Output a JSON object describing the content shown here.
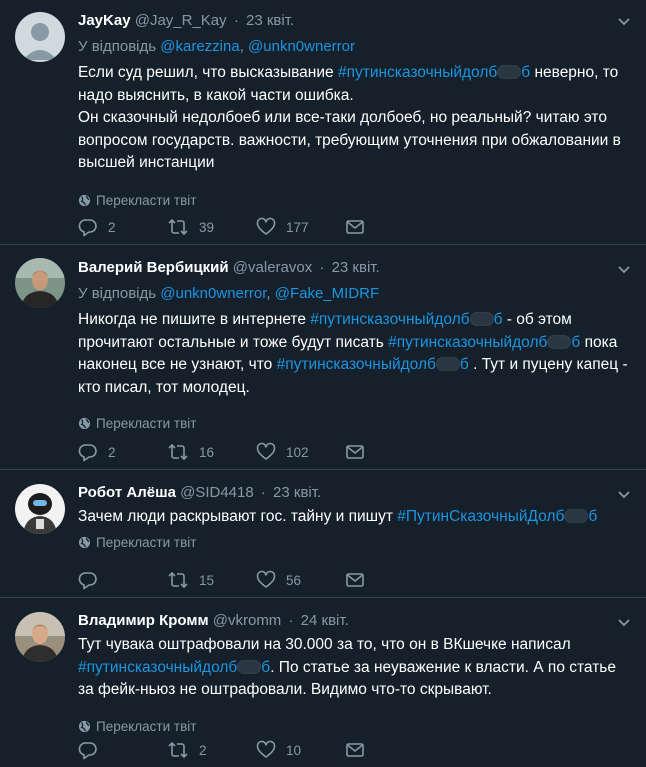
{
  "tweets": [
    {
      "name": "JayKay",
      "handle": "@Jay_R_Kay",
      "sep": "·",
      "date": "23 квіт.",
      "reply_prefix": "У відповідь",
      "reply_mentions": [
        "@karezzina",
        "@unkn0wnerror"
      ],
      "text_parts": [
        "Если суд решил, что высказывание ",
        "#путинсказочныйдолб",
        " неверно, то надо выяснить, в какой части ошибка.",
        "Он сказочный недолбоеб или все-таки долбоеб, но реальный? читаю это вопросом государств. важности, требующим уточнения при обжаловании в высшей инстанции"
      ],
      "translate": "Перекласти твіт",
      "replies": "2",
      "retweets": "39",
      "likes": "177"
    },
    {
      "name": "Валерий Вербицкий",
      "handle": "@valeravox",
      "sep": "·",
      "date": "23 квіт.",
      "reply_prefix": "У відповідь",
      "reply_mentions": [
        "@unkn0wnerror",
        "@Fake_MIDRF"
      ],
      "text_parts": [
        "Никогда не пишите в интернете ",
        "#путинсказочныйдолб",
        " - об этом прочитают остальные и тоже будут писать ",
        "#путинсказочныйдолб",
        " пока наконец все не узнают, что ",
        "#путинсказочныйдолб",
        " . Тут и пуцену капец - кто писал, тот молодец."
      ],
      "translate": "Перекласти твіт",
      "replies": "2",
      "retweets": "16",
      "likes": "102"
    },
    {
      "name": "Робот Алёша",
      "handle": "@SID4418",
      "sep": "·",
      "date": "23 квіт.",
      "text_parts": [
        "Зачем люди раскрывают гос. тайну и пишут ",
        "#ПутинСказочныйДол"
      ],
      "translate": "Перекласти твіт",
      "replies": "",
      "retweets": "15",
      "likes": "56"
    },
    {
      "name": "Владимир Кромм",
      "handle": "@vkromm",
      "sep": "·",
      "date": "24 квіт.",
      "text_parts": [
        "Тут чувака оштрафовали на 30.000 за то, что он в ВКшечке написал ",
        "#путинсказочныйдолб",
        ". По статье за неуважение к власти. А по статье за фейк-ньюз не оштрафовали. Видимо что-то скрывают."
      ],
      "translate": "Перекласти твіт",
      "replies": "",
      "retweets": "2",
      "likes": "10"
    }
  ],
  "colors": {
    "background": "#15202b",
    "link": "#1b95e0",
    "muted": "#8899a6",
    "divider": "#38444d"
  },
  "icons": [
    "chevron-down-icon",
    "globe-icon",
    "reply-icon",
    "retweet-icon",
    "like-icon",
    "message-icon",
    "avatar-icon"
  ]
}
